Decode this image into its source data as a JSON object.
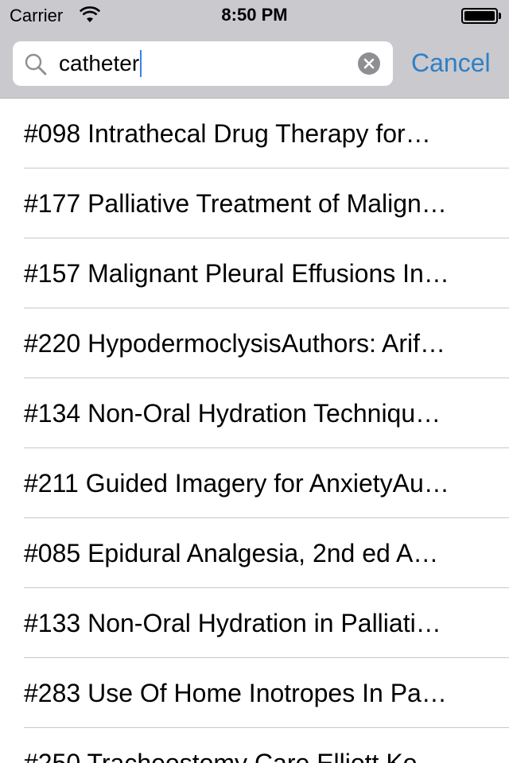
{
  "status_bar": {
    "carrier": "Carrier",
    "time": "8:50 PM"
  },
  "search": {
    "value": "catheter",
    "cancel_label": "Cancel"
  },
  "results": [
    "#098 Intrathecal Drug Therapy for…",
    "#177 Palliative Treatment of Malign…",
    "#157 Malignant Pleural Effusions In…",
    "#220 HypodermoclysisAuthors: Arif…",
    "#134 Non-Oral Hydration Techniqu…",
    "#211 Guided Imagery for AnxietyAu…",
    "#085 Epidural Analgesia, 2nd ed A…",
    "#133 Non-Oral Hydration in Palliati…",
    "#283 Use Of Home Inotropes In Pa…",
    "#250 Tracheostomy Care Elliott Ko…"
  ],
  "colors": {
    "accent": "#2f7fc4",
    "header_bg": "#c9c9ce",
    "separator": "#c8c7cc"
  }
}
